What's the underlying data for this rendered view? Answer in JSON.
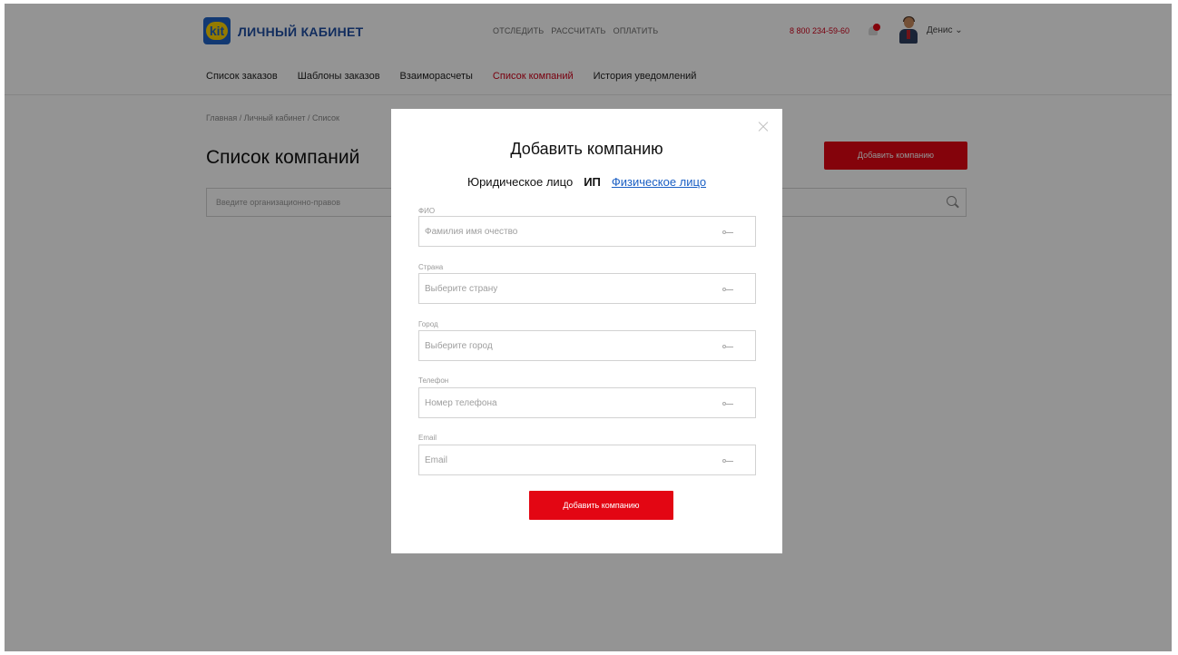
{
  "header": {
    "brand": "ЛИЧНЫЙ КАБИНЕТ",
    "logo_text": "kit",
    "top_links": [
      "ОТСЛЕДИТЬ",
      "РАССЧИТАТЬ",
      "ОПЛАТИТЬ"
    ],
    "phone": "8 800 234-59-60",
    "user_name": "Денис ⌄"
  },
  "nav": {
    "items": [
      {
        "label": "Список заказов",
        "active": false
      },
      {
        "label": "Шаблоны заказов",
        "active": false
      },
      {
        "label": "Взаиморасчеты",
        "active": false
      },
      {
        "label": "Список компаний",
        "active": true
      },
      {
        "label": "История уведомлений",
        "active": false
      }
    ]
  },
  "page": {
    "breadcrumb": "Главная / Личный кабинет / Список",
    "title": "Список компаний",
    "add_button": "Добавить компанию",
    "search_placeholder": "Введите организационно-правов"
  },
  "modal": {
    "title": "Добавить компанию",
    "tabs": [
      "Юридическое лицо",
      "ИП",
      "Физическое лицо"
    ],
    "fields": [
      {
        "label": "ФИО",
        "placeholder": "Фамилия имя очество"
      },
      {
        "label": "Страна",
        "placeholder": "Выберите страну"
      },
      {
        "label": "Город",
        "placeholder": "Выберите город"
      },
      {
        "label": "Телефон",
        "placeholder": "Номер телефона"
      },
      {
        "label": "Email",
        "placeholder": "Email"
      }
    ],
    "submit": "Добавить компанию"
  },
  "colors": {
    "accent_red": "#e30613",
    "link_blue": "#1a5fc4",
    "brand_blue": "#1f4fa3",
    "logo_yellow": "#ffd400"
  }
}
